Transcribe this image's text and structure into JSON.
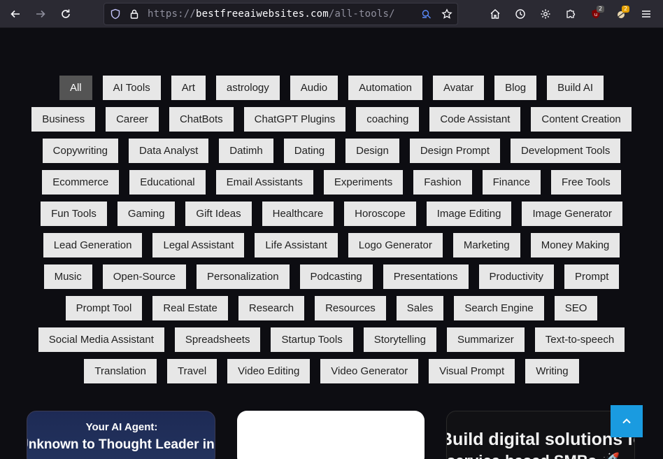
{
  "browser": {
    "url_prefix": "https://",
    "url_host": "bestfreeaiwebsites.com",
    "url_path": "/all-tools/",
    "badge_ublock": "2",
    "badge_ext": "2"
  },
  "tags": [
    "All",
    "AI Tools",
    "Art",
    "astrology",
    "Audio",
    "Automation",
    "Avatar",
    "Blog",
    "Build AI",
    "Business",
    "Career",
    "ChatBots",
    "ChatGPT Plugins",
    "coaching",
    "Code Assistant",
    "Content Creation",
    "Copywriting",
    "Data Analyst",
    "Datimh",
    "Dating",
    "Design",
    "Design Prompt",
    "Development Tools",
    "Ecommerce",
    "Educational",
    "Email Assistants",
    "Experiments",
    "Fashion",
    "Finance",
    "Free Tools",
    "Fun Tools",
    "Gaming",
    "Gift Ideas",
    "Healthcare",
    "Horoscope",
    "Image Editing",
    "Image Generator",
    "Lead Generation",
    "Legal Assistant",
    "Life Assistant",
    "Logo Generator",
    "Marketing",
    "Money Making",
    "Music",
    "Open-Source",
    "Personalization",
    "Podcasting",
    "Presentations",
    "Productivity",
    "Prompt",
    "Prompt Tool",
    "Real Estate",
    "Research",
    "Resources",
    "Sales",
    "Search Engine",
    "SEO",
    "Social Media Assistant",
    "Spreadsheets",
    "Startup Tools",
    "Storytelling",
    "Summarizer",
    "Text-to-speech",
    "Translation",
    "Travel",
    "Video Editing",
    "Video Generator",
    "Visual Prompt",
    "Writing"
  ],
  "active_tag": "All",
  "cards": {
    "card1_line1": "Your AI Agent:",
    "card1_line2": "Unknown to Thought Leader in",
    "card3_line1": "Build digital solutions for",
    "card3_line2": "service-based SMBs 🚀"
  },
  "colors": {
    "tag_bg": "#e7e7e7",
    "tag_active_bg": "#545454",
    "scroll_top": "#1a9be0",
    "page_bg": "#0d0d12"
  }
}
